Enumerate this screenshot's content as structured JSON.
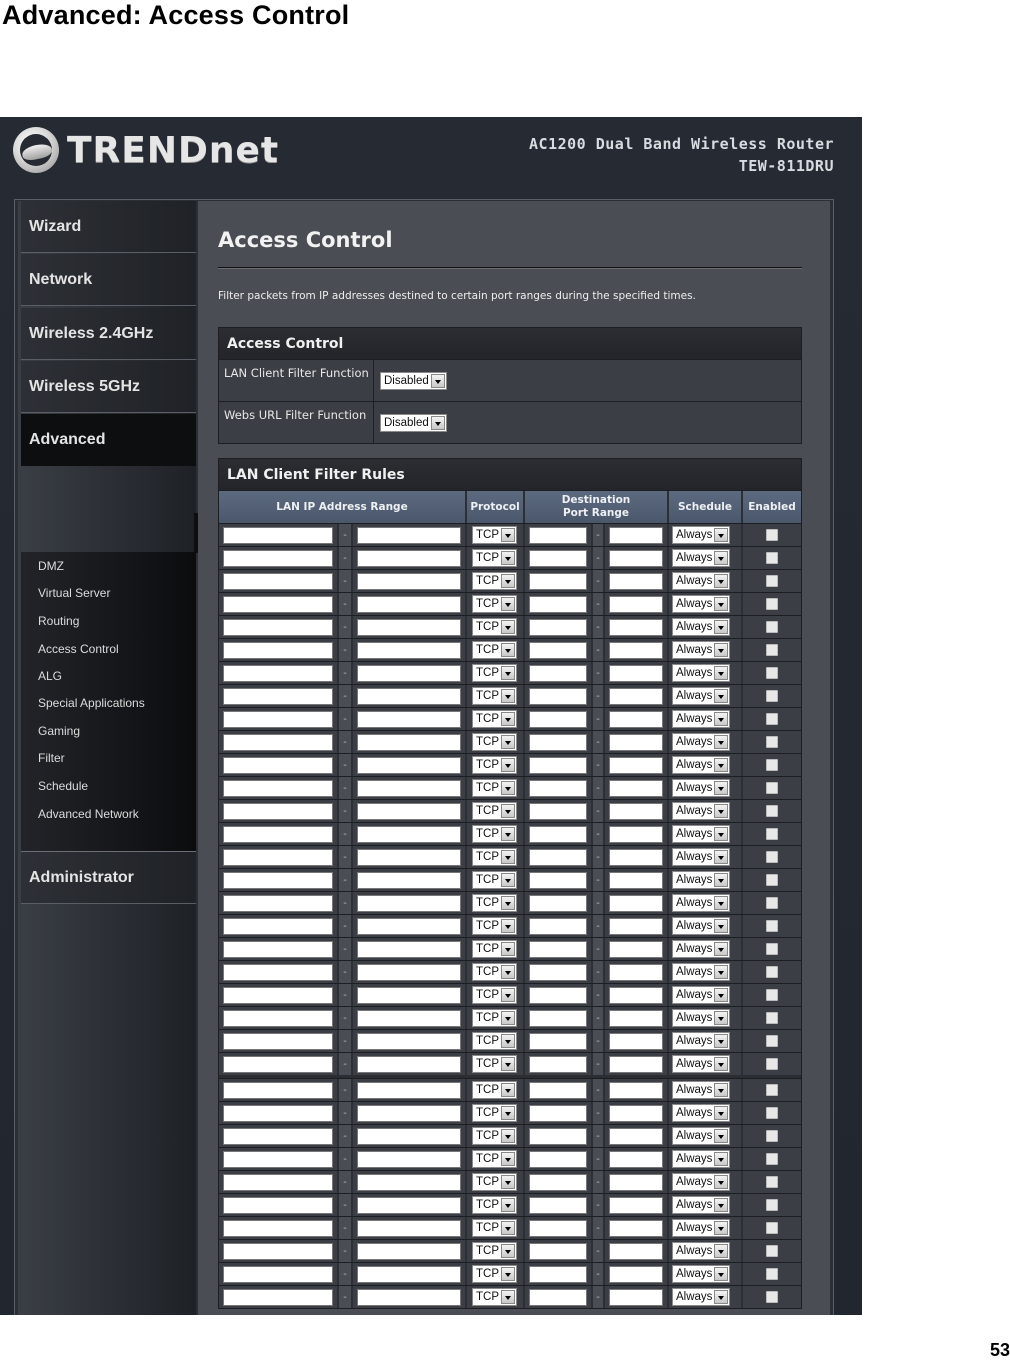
{
  "document": {
    "title": "Advanced: Access Control",
    "page_number": "53"
  },
  "header": {
    "brand": "TRENDnet",
    "product_line": "AC1200 Dual Band Wireless Router",
    "model": "TEW-811DRU"
  },
  "sidebar": {
    "items": [
      {
        "label": "Wizard"
      },
      {
        "label": "Network"
      },
      {
        "label": "Wireless 2.4GHz"
      },
      {
        "label": "Wireless 5GHz"
      },
      {
        "label": "Advanced",
        "active": true
      },
      {
        "label": "Administrator"
      }
    ],
    "advanced_submenu": [
      "DMZ",
      "Virtual Server",
      "Routing",
      "Access Control",
      "ALG",
      "Special Applications",
      "Gaming",
      "Filter",
      "Schedule",
      "Advanced Network"
    ]
  },
  "main": {
    "title": "Access Control",
    "description": "Filter packets from IP addresses destined to certain port ranges during the specified times.",
    "access_control_panel": {
      "title": "Access Control",
      "settings": [
        {
          "label": "LAN Client Filter Function",
          "value": "Disabled"
        },
        {
          "label": "Webs URL Filter Function",
          "value": "Disabled"
        }
      ]
    },
    "rules_panel": {
      "title": "LAN Client Filter Rules",
      "columns": {
        "ip_range": "LAN IP Address Range",
        "protocol": "Protocol",
        "dest_port_line1": "Destination",
        "dest_port_line2": "Port Range",
        "schedule": "Schedule",
        "enabled": "Enabled"
      },
      "range_separator": "-",
      "row_blocks": [
        24,
        10
      ],
      "row_defaults": {
        "ip_start": "",
        "ip_end": "",
        "protocol": "TCP",
        "port_start": "",
        "port_end": "",
        "schedule": "Always",
        "enabled": false
      }
    }
  }
}
